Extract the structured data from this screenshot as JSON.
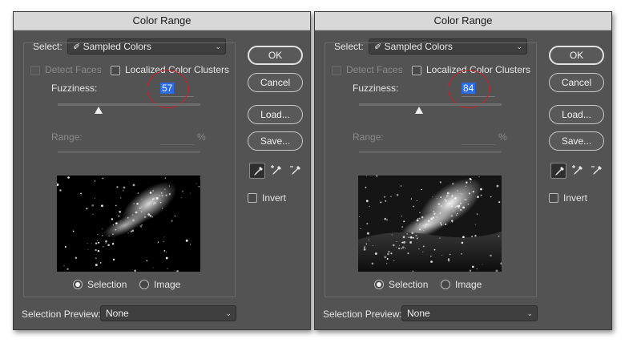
{
  "dialogs": [
    {
      "title": "Color Range",
      "select_label": "Select:",
      "select_value": "Sampled Colors",
      "detect_faces_label": "Detect Faces",
      "localized_clusters_label": "Localized Color Clusters",
      "fuzziness_label": "Fuzziness:",
      "fuzziness_value": "57",
      "fuzziness_fraction": 0.285,
      "range_label": "Range:",
      "range_unit": "%",
      "selection_label": "Selection",
      "image_label": "Image",
      "selection_preview_label": "Selection Preview:",
      "selection_preview_value": "None",
      "ok_label": "OK",
      "cancel_label": "Cancel",
      "load_label": "Load...",
      "save_label": "Save...",
      "invert_label": "Invert"
    },
    {
      "title": "Color Range",
      "select_label": "Select:",
      "select_value": "Sampled Colors",
      "detect_faces_label": "Detect Faces",
      "localized_clusters_label": "Localized Color Clusters",
      "fuzziness_label": "Fuzziness:",
      "fuzziness_value": "84",
      "fuzziness_fraction": 0.42,
      "range_label": "Range:",
      "range_unit": "%",
      "selection_label": "Selection",
      "image_label": "Image",
      "selection_preview_label": "Selection Preview:",
      "selection_preview_value": "None",
      "ok_label": "OK",
      "cancel_label": "Cancel",
      "load_label": "Load...",
      "save_label": "Save...",
      "invert_label": "Invert"
    }
  ],
  "icons": {
    "select_dropdown": "eyedropper-icon",
    "tools": [
      "eyedropper-icon",
      "eyedropper-plus-icon",
      "eyedropper-minus-icon"
    ]
  },
  "colors": {
    "highlight": "#2d6be0",
    "annotation_circle": "#d0202a"
  }
}
